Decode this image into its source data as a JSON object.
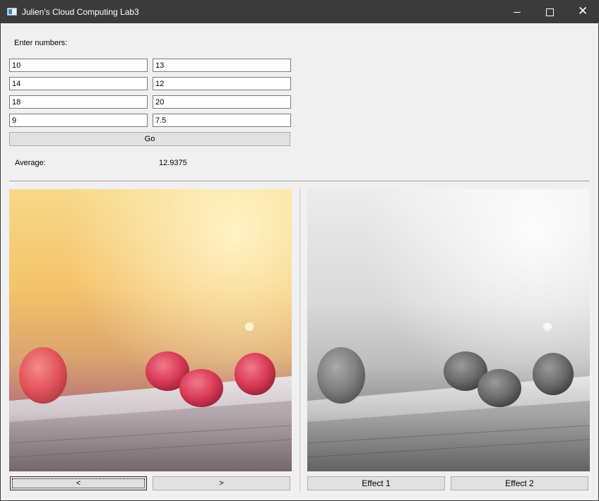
{
  "window": {
    "title": "Julien's Cloud Computing Lab3",
    "controls": {
      "minimize": "—",
      "maximize": "☐",
      "close": "✕"
    }
  },
  "form": {
    "prompt": "Enter numbers:",
    "inputs": [
      "10",
      "13",
      "14",
      "12",
      "18",
      "20",
      "9",
      "7.5"
    ],
    "go_label": "Go",
    "average_label": "Average:",
    "average_value": "12.9375"
  },
  "images": {
    "left": {
      "description_icon": "photo-raspberries-color"
    },
    "right": {
      "description_icon": "photo-raspberries-grayscale"
    }
  },
  "buttons": {
    "prev_label": "<",
    "next_label": ">",
    "effect1_label": "Effect 1",
    "effect2_label": "Effect 2"
  },
  "colors": {
    "titlebar": "#3b3b3b",
    "window_bg": "#f0f0f0",
    "button_bg": "#e1e1e1"
  }
}
